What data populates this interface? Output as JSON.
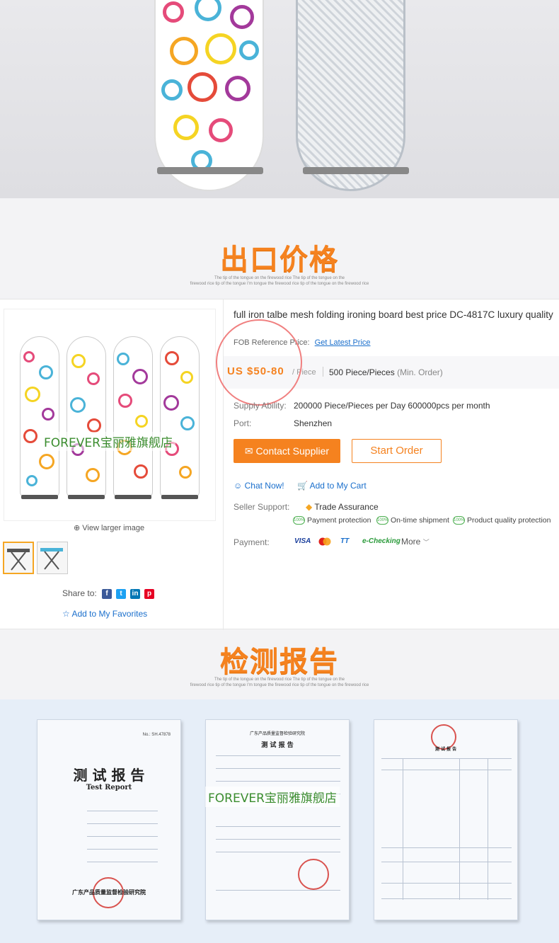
{
  "sections": {
    "export_price_title": "出口价格",
    "test_report_title": "检测报告",
    "tagline_line1": "The tip of the tongue on the firewood rice The tip of the tongue on the",
    "tagline_line2": "firewood rice tip of the tongue I'm tongue the firewood rice tip of the tongue on the firewood rice"
  },
  "product": {
    "title": "full iron talbe mesh folding ironing board best price DC-4817C luxury quality",
    "fob_label": "FOB Reference Price:",
    "fob_link": "Get Latest Price",
    "price": "US $50-80",
    "price_unit": "/ Piece",
    "moq": "500 Piece/Pieces",
    "moq_note": "(Min. Order)",
    "supply_label": "Supply Ability:",
    "supply_value": "200000 Piece/Pieces per Day 600000pcs per month",
    "port_label": "Port:",
    "port_value": "Shenzhen",
    "contact_button": "Contact Supplier",
    "order_button": "Start Order",
    "chat_link": "Chat Now!",
    "cart_link": "Add to My Cart",
    "seller_support_label": "Seller Support:",
    "trade_assurance": "Trade Assurance",
    "badges": [
      "Payment protection",
      "On-time shipment",
      "Product quality protection"
    ],
    "badge_icon_text": "100%",
    "payment_label": "Payment:",
    "payment_methods": [
      "VISA",
      "TT",
      "e-Checking"
    ],
    "more": "More",
    "watermark": "FOREVER宝丽雅旗舰店",
    "view_larger": "View larger image",
    "share_label": "Share to:",
    "favorites": "Add to My Favorites"
  },
  "reports": {
    "doc1_title": "测 试 报 告",
    "doc1_subtitle": "Test Report",
    "doc1_number": "No.: SH.47878",
    "doc1_footer": "广东产品质量监督检验研究院",
    "doc2_header": "广东产品质量监督检验研究院",
    "doc2_title": "测 试 报 告",
    "doc3_title": "测 试 报 告",
    "watermark": "FOREVER宝丽雅旗舰店"
  },
  "colors": {
    "accent": "#f5821f",
    "link": "#1a6fcc",
    "watermark": "#3b8d2f"
  }
}
